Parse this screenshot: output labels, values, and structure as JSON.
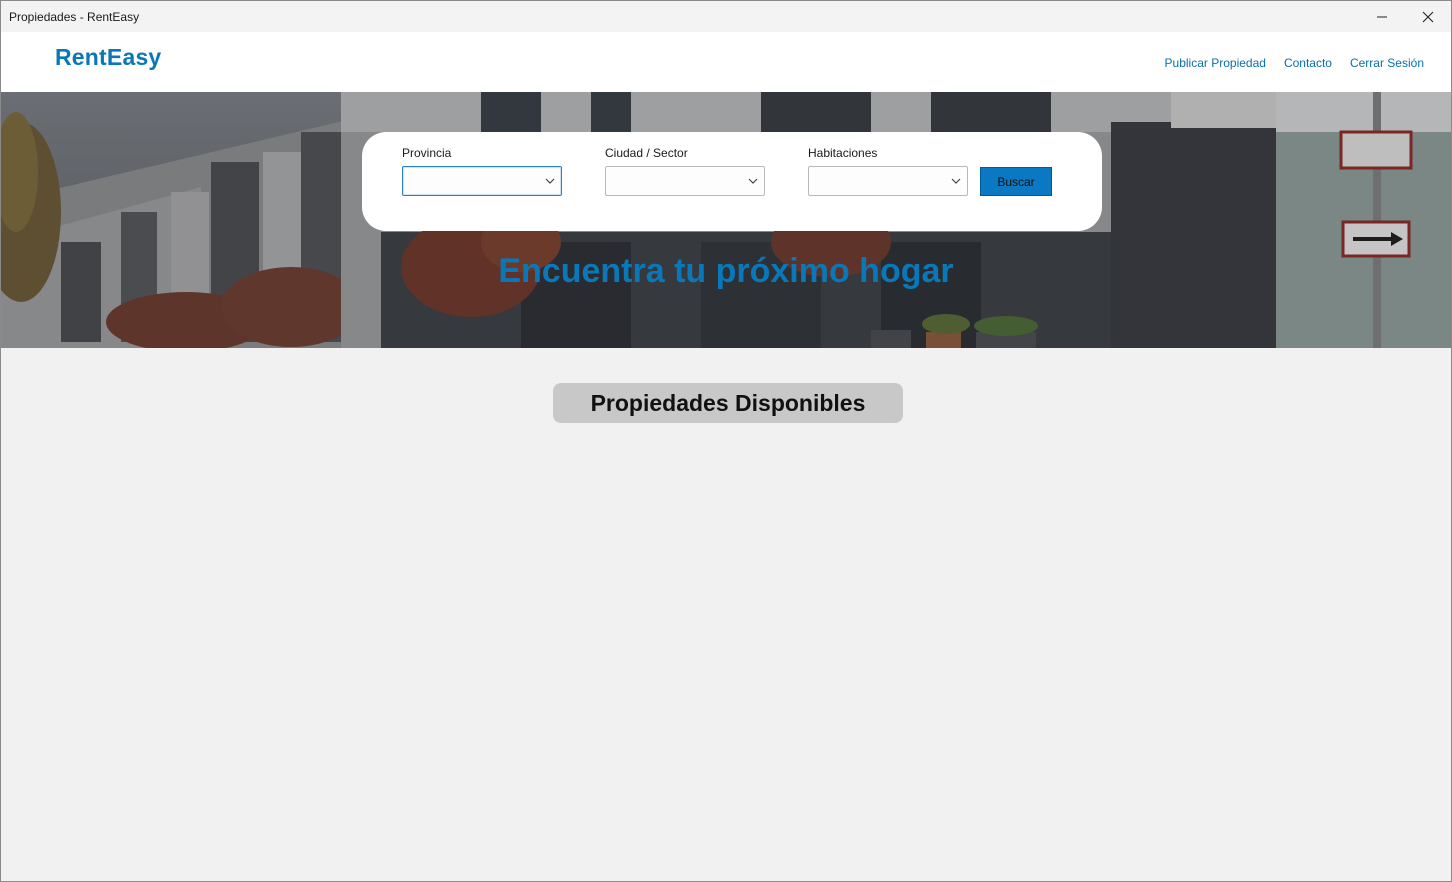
{
  "window": {
    "title": "Propiedades - RentEasy"
  },
  "header": {
    "brand": "RentEasy",
    "nav": [
      {
        "label": "Publicar Propiedad"
      },
      {
        "label": "Contacto"
      },
      {
        "label": "Cerrar Sesión"
      }
    ]
  },
  "search": {
    "provincia_label": "Provincia",
    "provincia_value": "",
    "ciudad_label": "Ciudad / Sector",
    "ciudad_value": "",
    "habitaciones_label": "Habitaciones",
    "habitaciones_value": "",
    "button_label": "Buscar"
  },
  "hero": {
    "title": "Encuentra tu próximo hogar"
  },
  "section": {
    "title": "Propiedades Disponibles"
  },
  "colors": {
    "accent": "#0a78b8",
    "button": "#0a78c2"
  },
  "icons": [
    "minimize-icon",
    "close-icon",
    "chevron-down-icon"
  ]
}
